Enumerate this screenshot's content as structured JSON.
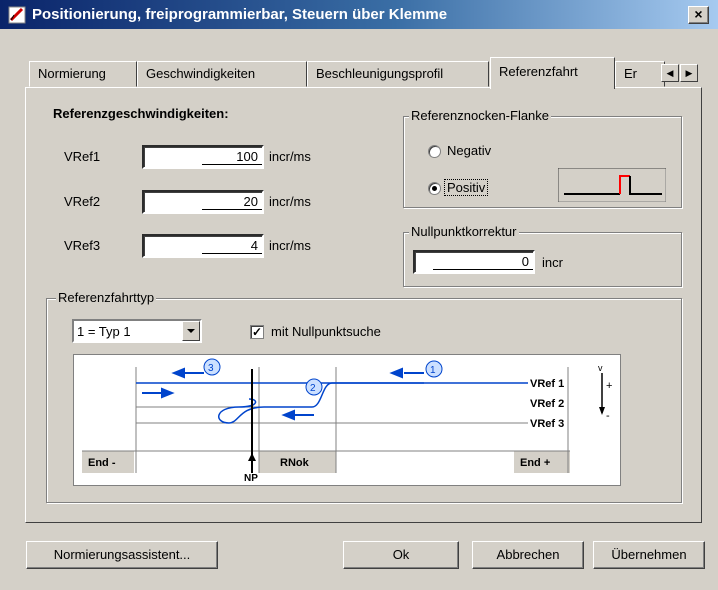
{
  "window": {
    "title": "Positionierung, freiprogrammierbar, Steuern über Klemme",
    "close_glyph": "×"
  },
  "tabs": [
    {
      "label": "Normierung",
      "active": false
    },
    {
      "label": "Geschwindigkeiten",
      "active": false
    },
    {
      "label": "Beschleunigungsprofil",
      "active": false
    },
    {
      "label": "Referenzfahrt",
      "active": true
    },
    {
      "label": "Er",
      "active": false
    }
  ],
  "tab_scroll": {
    "left_glyph": "◀",
    "right_glyph": "▶"
  },
  "ref_speeds": {
    "heading": "Referenzgeschwindigkeiten:",
    "rows": [
      {
        "label": "VRef1",
        "value": "100",
        "unit": "incr/ms"
      },
      {
        "label": "VRef2",
        "value": "20",
        "unit": "incr/ms"
      },
      {
        "label": "VRef3",
        "value": "4",
        "unit": "incr/ms"
      }
    ]
  },
  "cam_edge": {
    "legend": "Referenznocken-Flanke",
    "options": [
      {
        "label": "Negativ",
        "selected": false
      },
      {
        "label": "Positiv",
        "selected": true
      }
    ],
    "edge_color": "#ff0000"
  },
  "zero_correction": {
    "legend": "Nullpunktkorrektur",
    "value": "0",
    "unit": "incr"
  },
  "ref_type": {
    "legend": "Referenzfahrttyp",
    "selected": "1 = Typ 1",
    "checkbox_label": "mit Nullpunktsuche",
    "checkbox_checked": true,
    "diagram": {
      "markers": [
        "1",
        "2",
        "3"
      ],
      "speed_labels": [
        "VRef 1",
        "VRef 2",
        "VRef 3"
      ],
      "end_left": "End -",
      "end_right": "End +",
      "cam_label": "RNok",
      "np_label": "NP",
      "v_label": "v",
      "plus": "+",
      "minus": "-",
      "accent_color": "#0044cc"
    }
  },
  "buttons": {
    "assistant": "Normierungsassistent...",
    "ok": "Ok",
    "cancel": "Abbrechen",
    "apply": "Übernehmen"
  }
}
